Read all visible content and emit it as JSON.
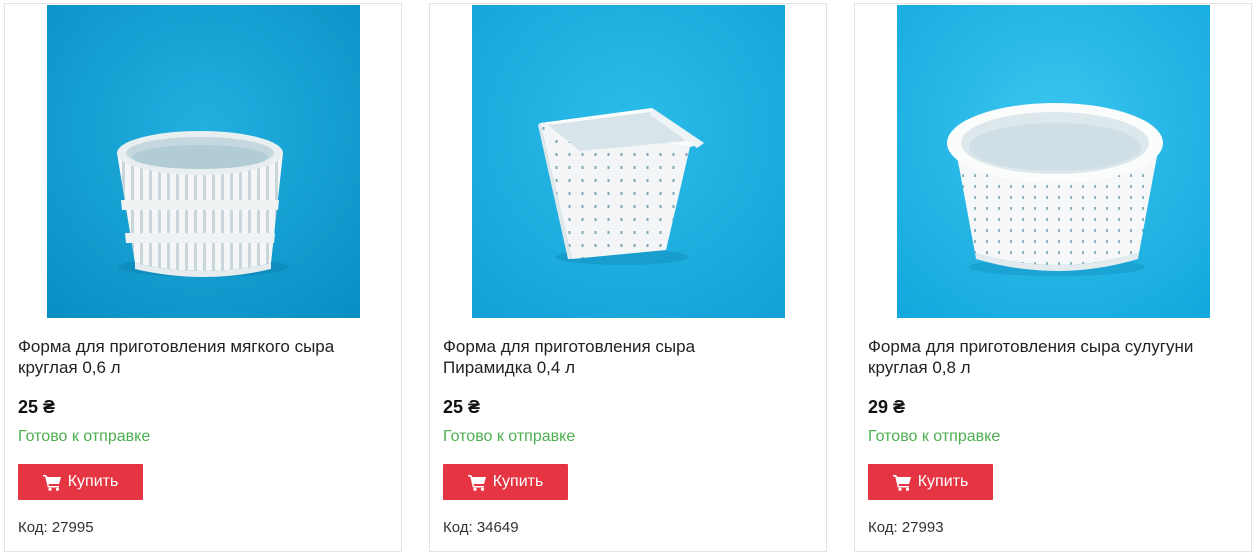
{
  "products": [
    {
      "title": "Форма для приготовления мягкого сыра круглая 0,6 л",
      "price": "25 ₴",
      "stock": "Готово к отправке",
      "buy_label": "Купить",
      "code": "Код: 27995",
      "image": "round-slotted-cheese-mold"
    },
    {
      "title": "Форма для приготовления сыра Пирамидка 0,4 л",
      "price": "25 ₴",
      "stock": "Готово к отправке",
      "buy_label": "Купить",
      "code": "Код: 34649",
      "image": "pyramid-perforated-cheese-mold"
    },
    {
      "title": "Форма для приготовления сыра сулугуни круглая 0,8 л",
      "price": "29 ₴",
      "stock": "Готово к отправке",
      "buy_label": "Купить",
      "code": "Код: 27993",
      "image": "round-perforated-cheese-mold"
    }
  ],
  "colors": {
    "buy_button": "#e53543",
    "stock_text": "#4caf50",
    "photo_background": "#1aa6d8"
  }
}
